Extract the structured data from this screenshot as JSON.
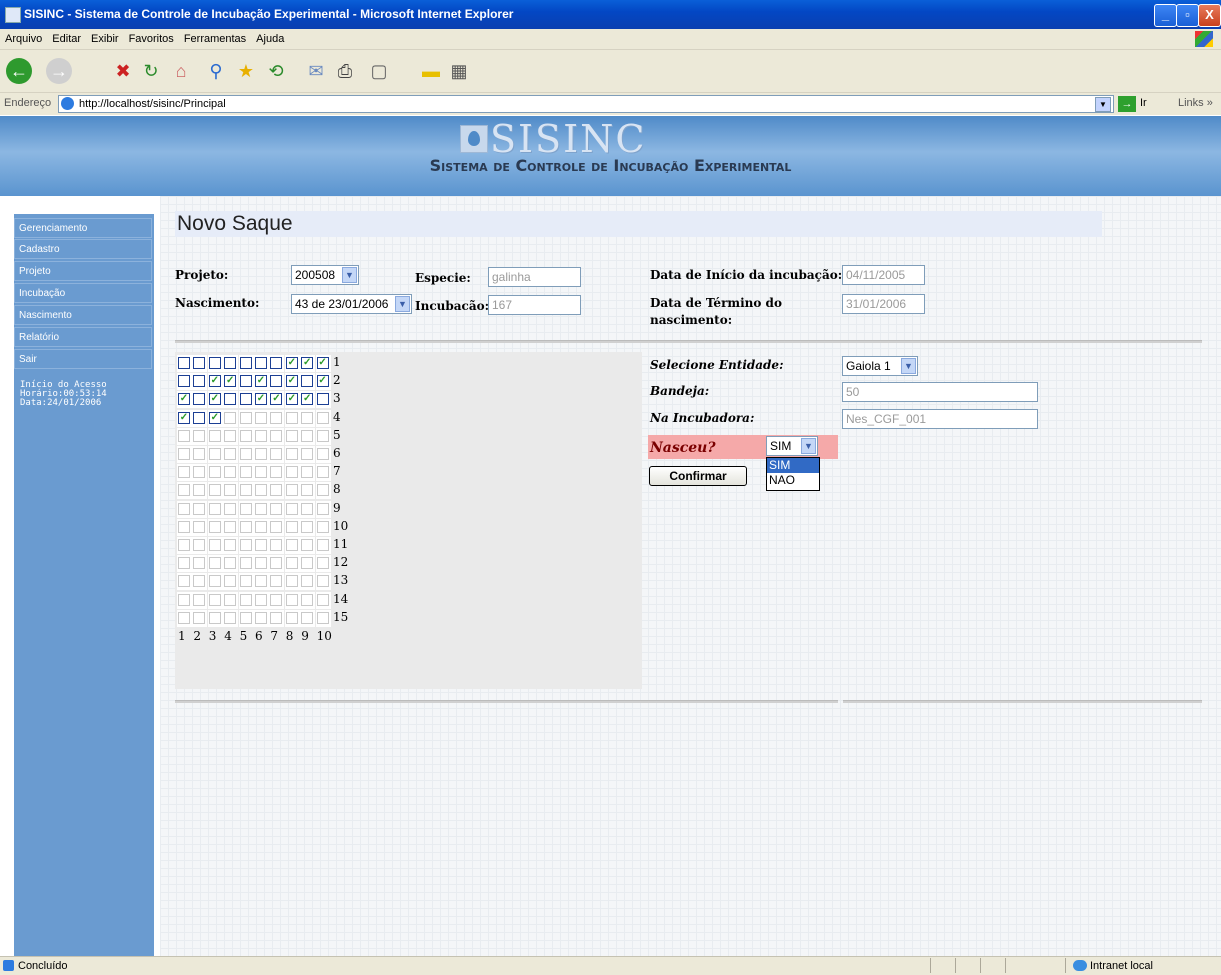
{
  "window": {
    "title": "SISINC - Sistema de Controle de Incubação Experimental - Microsoft Internet Explorer",
    "minimize": "_",
    "maximize": "▫",
    "close": "X"
  },
  "menu": [
    "Arquivo",
    "Editar",
    "Exibir",
    "Favoritos",
    "Ferramentas",
    "Ajuda"
  ],
  "address": {
    "label": "Endereço",
    "url": "http://localhost/sisinc/Principal",
    "go": "Ir",
    "links": "Links »"
  },
  "header": {
    "brand": "SISINC",
    "subtitle": "Sistema de Controle de Incubação Experimental"
  },
  "sidebar": {
    "items": [
      "Gerenciamento",
      "Cadastro",
      "Projeto",
      "Incubação",
      "Nascimento",
      "Relatório",
      "Sair"
    ],
    "info": [
      "Início do Acesso",
      "Horário:00:53:14",
      "Data:24/01/2006"
    ]
  },
  "page": {
    "title": "Novo Saque",
    "projeto_label": "Projeto:",
    "projeto_value": "200508",
    "especie_label": "Especie:",
    "especie_value": "galinha",
    "nascimento_label": "Nascimento:",
    "nascimento_value": "43 de 23/01/2006",
    "incubacao_label": "Incubacão:",
    "incubacao_value": "167",
    "inicio_label": "Data de Início da incubação:",
    "inicio_value": "04/11/2005",
    "termino_label1": "Data de Término do",
    "termino_label2": "nascimento:",
    "termino_value": "31/01/2006"
  },
  "grid": {
    "rows": [
      "1",
      "2",
      "3",
      "4",
      "5",
      "6",
      "7",
      "8",
      "9",
      "10",
      "11",
      "12",
      "13",
      "14",
      "15"
    ],
    "cols": [
      "1",
      "2",
      "3",
      "4",
      "5",
      "6",
      "7",
      "8",
      "9",
      "10"
    ],
    "checked": [
      [
        0,
        0,
        0,
        0,
        0,
        0,
        0,
        1,
        1,
        1
      ],
      [
        0,
        0,
        1,
        1,
        0,
        1,
        0,
        1,
        0,
        1
      ],
      [
        1,
        0,
        1,
        0,
        0,
        1,
        1,
        1,
        1,
        0
      ],
      [
        1,
        0,
        1
      ]
    ],
    "enabled_cells_per_row": [
      10,
      10,
      10,
      3,
      0,
      0,
      0,
      0,
      0,
      0,
      0,
      0,
      0,
      0,
      0
    ],
    "checkmark": "✓"
  },
  "entity": {
    "entidade_label": "Selecione Entidade:",
    "entidade_value": "Gaiola 1",
    "bandeja_label": "Bandeja:",
    "bandeja_value": "50",
    "incubadora_label": "Na Incubadora:",
    "incubadora_value": "Nes_CGF_001",
    "nasceu_label": "Nasceu?",
    "nasceu_value": "SIM",
    "nasceu_options": [
      "SIM",
      "NAO"
    ],
    "confirm": "Confirmar"
  },
  "status": {
    "text": "Concluído",
    "zone": "Intranet local"
  },
  "colors": {
    "sidebar": "#6a9bd0",
    "banner": "#8cb7e2",
    "nasceu_bg": "#f5a9a9",
    "selected": "#316ac5"
  }
}
